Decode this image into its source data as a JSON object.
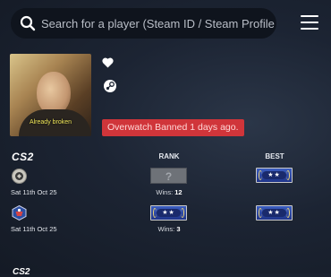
{
  "search": {
    "placeholder": "Search for a player (Steam ID / Steam Profile Link"
  },
  "profile": {
    "avatar_caption": "Already broken",
    "ban_text": "Overwatch Banned 1 days ago."
  },
  "cs2": {
    "game_label": "CS2",
    "headers": {
      "rank": "RANK",
      "best": "BEST"
    },
    "rows": [
      {
        "mode_icon": "premier-icon",
        "date": "Sat 11th Oct 25",
        "rank": "?",
        "wins_label": "Wins:",
        "wins": "12",
        "best_rank": "★★"
      },
      {
        "mode_icon": "competitive-icon",
        "date": "Sat 11th Oct 25",
        "rank": "★★",
        "wins_label": "Wins:",
        "wins": "3",
        "best_rank": "★★"
      }
    ]
  },
  "colors": {
    "ban": "#d0353a",
    "rank_blue": "#2e4aa8",
    "background": "#1c2433"
  },
  "bottom_label": "CS2"
}
